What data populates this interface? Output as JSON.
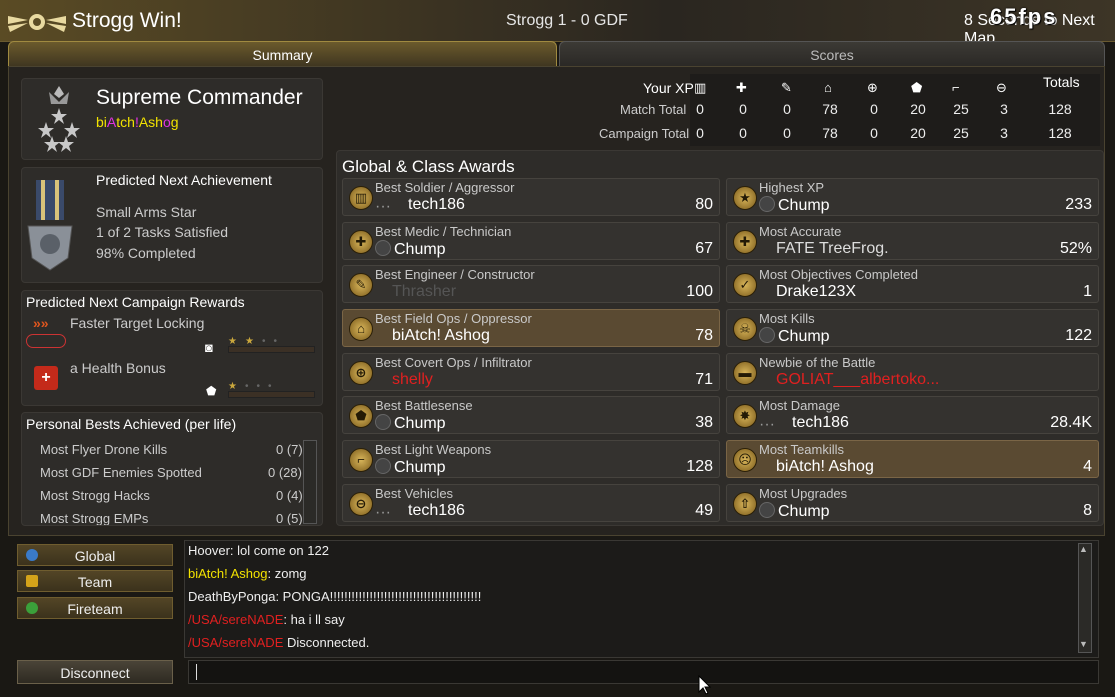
{
  "header": {
    "title": "Strogg Win!",
    "match": "Strogg 1 - 0 GDF",
    "next_map": "8 Seconds to Next Map",
    "fps": "65fps"
  },
  "tabs": {
    "summary": "Summary",
    "scores": "Scores"
  },
  "rank": {
    "name": "Supreme Commander",
    "user": [
      "bi",
      "A",
      "tch",
      "!",
      "Ash",
      "o",
      "g"
    ]
  },
  "next_achievement": {
    "title": "Predicted Next Achievement",
    "name": "Small Arms Star",
    "tasks": "1 of 2 Tasks Satisfied",
    "completed": "98% Completed"
  },
  "campaign_rewards": {
    "title": "Predicted Next Campaign Rewards",
    "items": [
      {
        "label": "Faster Target Locking"
      },
      {
        "label": "a Health Bonus"
      }
    ]
  },
  "personal_bests": {
    "title": "Personal Bests Achieved (per life)",
    "rows": [
      {
        "label": "Most Flyer Drone Kills",
        "value": "0 (7)"
      },
      {
        "label": "Most GDF Enemies Spotted",
        "value": "0 (28)"
      },
      {
        "label": "Most Strogg Hacks",
        "value": "0 (4)"
      },
      {
        "label": "Most Strogg EMPs",
        "value": "0 (5)"
      }
    ]
  },
  "xp": {
    "your_xp": "Your XP",
    "totals": "Totals",
    "rows": [
      {
        "label": "Match Total",
        "values": [
          "0",
          "0",
          "0",
          "78",
          "0",
          "20",
          "25",
          "3",
          "128"
        ]
      },
      {
        "label": "Campaign Total",
        "values": [
          "0",
          "0",
          "0",
          "78",
          "0",
          "20",
          "25",
          "3",
          "128"
        ]
      }
    ],
    "icons": [
      "soldier-icon",
      "medic-icon",
      "engineer-icon",
      "field-ops-icon",
      "covert-ops-icon",
      "battlesense-icon",
      "light-weapons-icon",
      "vehicles-icon"
    ]
  },
  "awards": {
    "title": "Global & Class Awards",
    "left": [
      {
        "cat": "Best Soldier / Aggressor",
        "player": "tech186",
        "value": "80"
      },
      {
        "cat": "Best Medic / Technician",
        "player": "Chump",
        "value": "67"
      },
      {
        "cat": "Best Engineer / Constructor",
        "player": "Thrasher",
        "value": "100"
      },
      {
        "cat": "Best Field Ops / Oppressor",
        "player": "biAtch! Ashog",
        "value": "78"
      },
      {
        "cat": "Best Covert Ops / Infiltrator",
        "player": "shelly",
        "value": "71"
      },
      {
        "cat": "Best Battlesense",
        "player": "Chump",
        "value": "38"
      },
      {
        "cat": "Best Light Weapons",
        "player": "Chump",
        "value": "128"
      },
      {
        "cat": "Best Vehicles",
        "player": "tech186",
        "value": "49"
      }
    ],
    "right": [
      {
        "cat": "Highest XP",
        "player": "Chump",
        "value": "233"
      },
      {
        "cat": "Most Accurate",
        "player": "FATE TreeFrog.",
        "value": "52%"
      },
      {
        "cat": "Most Objectives Completed",
        "player": "Drake123X",
        "value": "1"
      },
      {
        "cat": "Most Kills",
        "player": "Chump",
        "value": "122"
      },
      {
        "cat": "Newbie of the Battle",
        "player": "GOLIAT___albertoko...",
        "value": ""
      },
      {
        "cat": "Most Damage",
        "player": "tech186",
        "value": "28.4K"
      },
      {
        "cat": "Most Teamkills",
        "player": "biAtch! Ashog",
        "value": "4"
      },
      {
        "cat": "Most Upgrades",
        "player": "Chump",
        "value": "8"
      }
    ]
  },
  "channels": {
    "global": "Global",
    "team": "Team",
    "fireteam": "Fireteam"
  },
  "chat": [
    {
      "name": "Hoover",
      "msg": ": lol come on 122"
    },
    {
      "name": "biAtch! Ashog",
      "msg": ": zomg"
    },
    {
      "name": "DeathByPonga",
      "msg": ": PONGA!!!!!!!!!!!!!!!!!!!!!!!!!!!!!!!!!!!!!!!!!!"
    },
    {
      "name": "/USA/sereNADE",
      "msg": ": ha i ll say"
    },
    {
      "name": "/USA/sereNADE",
      "msg": " Disconnected."
    }
  ],
  "disconnect": "Disconnect"
}
